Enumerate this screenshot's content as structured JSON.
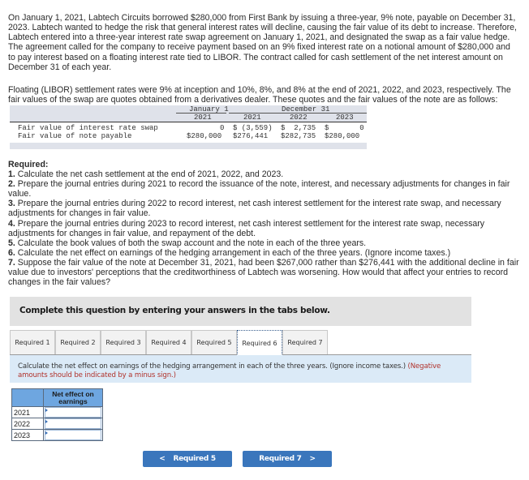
{
  "problem": {
    "paragraph1": "On January 1, 2021, Labtech Circuits borrowed $280,000 from First Bank by issuing a three-year, 9% note, payable on December 31, 2023. Labtech wanted to hedge the risk that general interest rates will decline, causing the fair value of its debt to increase. Therefore, Labtech entered into a three-year interest rate swap agreement on January 1, 2021, and designated the swap as a fair value hedge. The agreement called for the company to receive payment based on an 9% fixed interest rate on a notional amount of $280,000 and to pay interest based on a floating interest rate tied to LIBOR. The contract called for cash settlement of the net interest amount on December 31 of each year.",
    "paragraph2": "Floating (LIBOR) settlement rates were 9% at inception and 10%, 8%, and 8% at the end of 2021, 2022, and 2023, respectively. The fair values of the swap are quotes obtained from a derivatives dealer. These quotes and the fair values of the note are as follows:"
  },
  "fair_value_table": {
    "group_headers": [
      "January 1",
      "December 31"
    ],
    "years": [
      "2021",
      "2021",
      "2022",
      "2023"
    ],
    "rows": [
      {
        "label": "Fair value of interest rate swap",
        "values": [
          "0",
          "$ (3,559)",
          "$  2,735",
          "$       0"
        ]
      },
      {
        "label": "Fair value of note payable",
        "values": [
          "$280,000",
          "$276,441",
          "$282,735",
          "$280,000"
        ]
      }
    ]
  },
  "required": {
    "title": "Required:",
    "items": [
      {
        "num": "1.",
        "text": " Calculate the net cash settlement at the end of 2021, 2022, and 2023."
      },
      {
        "num": "2.",
        "text": " Prepare the journal entries during 2021 to record the issuance of the note, interest, and necessary adjustments for changes in fair value."
      },
      {
        "num": "3.",
        "text": " Prepare the journal entries during 2022 to record interest, net cash interest settlement for the interest rate swap, and necessary adjustments for changes in fair value."
      },
      {
        "num": "4.",
        "text": " Prepare the journal entries during 2023 to record interest, net cash interest settlement for the interest rate swap, necessary adjustments for changes in fair value, and repayment of the debt."
      },
      {
        "num": "5.",
        "text": " Calculate the book values of both the swap account and the note in each of the three years."
      },
      {
        "num": "6.",
        "text": " Calculate the net effect on earnings of the hedging arrangement in each of the three years. (Ignore income taxes.)"
      },
      {
        "num": "7.",
        "text": " Suppose the fair value of the note at December 31, 2021, had been $267,000 rather than $276,441 with the additional decline in fair value due to investors' perceptions that the creditworthiness of Labtech was worsening. How would that affect your entries to record changes in the fair values?"
      }
    ]
  },
  "complete_bar": {
    "text": "Complete this question by entering your answers in the tabs below."
  },
  "tabs": [
    {
      "label": "Required 1",
      "active": false
    },
    {
      "label": "Required 2",
      "active": false
    },
    {
      "label": "Required 3",
      "active": false
    },
    {
      "label": "Required 4",
      "active": false
    },
    {
      "label": "Required 5",
      "active": false
    },
    {
      "label": "Required 6",
      "active": true
    },
    {
      "label": "Required 7",
      "active": false
    }
  ],
  "instructions": {
    "text": "Calculate the net effect on earnings of the hedging arrangement in each of the three years. (Ignore income taxes.) ",
    "note": "(Negative amounts should be indicated by a minus sign.)"
  },
  "answer_table": {
    "column_header": "Net effect on earnings",
    "rows": [
      {
        "year": "2021",
        "value": ""
      },
      {
        "year": "2022",
        "value": ""
      },
      {
        "year": "2023",
        "value": ""
      }
    ]
  },
  "navigation": {
    "prev_label": "Required 5",
    "prev_icon": "chevron-left-icon",
    "prev_glyph": "<",
    "next_label": "Required 7",
    "next_icon": "chevron-right-icon",
    "next_glyph": ">"
  },
  "colors": {
    "nav_button": "#3a76bc",
    "instruction_bg": "#dbeaf7",
    "negative_note": "#b0312a",
    "answer_header": "#6ea6e0"
  }
}
